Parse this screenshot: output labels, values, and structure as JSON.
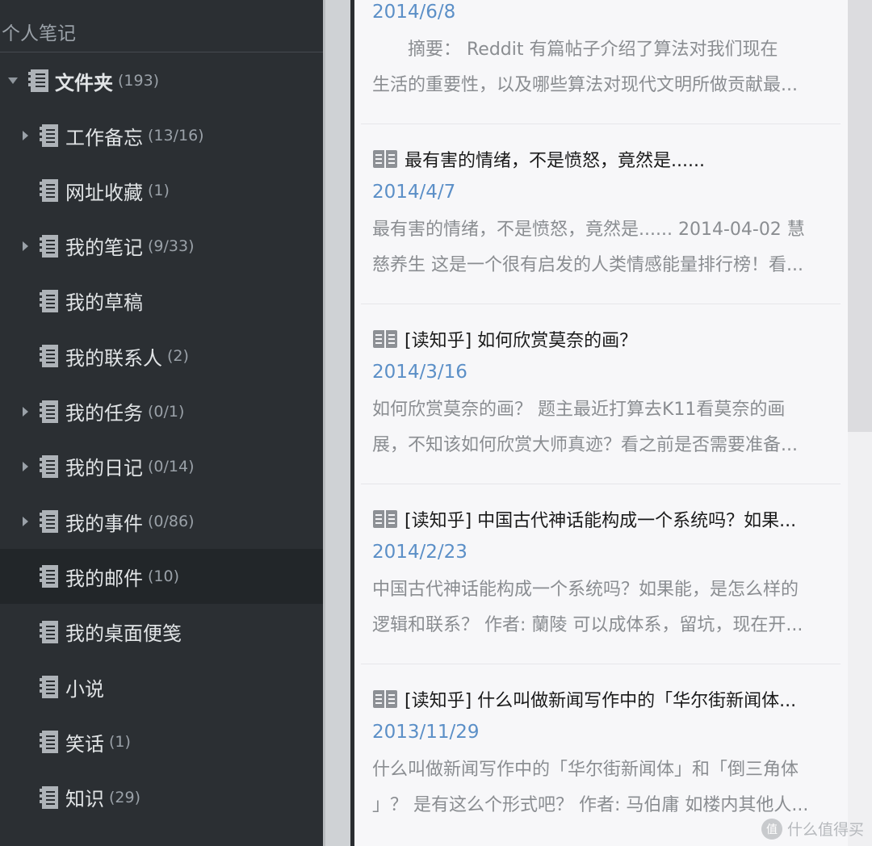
{
  "sidebar": {
    "header": "个人笔记",
    "root": {
      "label": "文件夹",
      "count": "(193)"
    },
    "items": [
      {
        "label": "工作备忘",
        "count": "(13/16)",
        "expandable": true
      },
      {
        "label": "网址收藏",
        "count": "(1)",
        "expandable": false
      },
      {
        "label": "我的笔记",
        "count": "(9/33)",
        "expandable": true
      },
      {
        "label": "我的草稿",
        "count": "",
        "expandable": false
      },
      {
        "label": "我的联系人",
        "count": "(2)",
        "expandable": false
      },
      {
        "label": "我的任务",
        "count": "(0/1)",
        "expandable": true
      },
      {
        "label": "我的日记",
        "count": "(0/14)",
        "expandable": true
      },
      {
        "label": "我的事件",
        "count": "(0/86)",
        "expandable": true
      },
      {
        "label": "我的邮件",
        "count": "(10)",
        "expandable": false,
        "selected": true
      },
      {
        "label": "我的桌面便笺",
        "count": "",
        "expandable": false
      },
      {
        "label": "小说",
        "count": "",
        "expandable": false
      },
      {
        "label": "笑话",
        "count": "(1)",
        "expandable": false
      },
      {
        "label": "知识",
        "count": "(29)",
        "expandable": false
      }
    ]
  },
  "notes": [
    {
      "title": "",
      "date": "2014/6/8",
      "snippet": [
        "　　摘要： Reddit 有篇帖子介绍了算法对我们现在",
        "生活的重要性，以及哪些算法对现代文明所做贡献最..."
      ]
    },
    {
      "title": "最有害的情绪，不是愤怒，竟然是......",
      "date": "2014/4/7",
      "snippet": [
        "最有害的情绪，不是愤怒，竟然是...... 2014-04-02 慧",
        "慈养生 这是一个很有启发的人类情感能量排行榜！看..."
      ]
    },
    {
      "title": "[读知乎] 如何欣赏莫奈的画？",
      "date": "2014/3/16",
      "snippet": [
        " 如何欣赏莫奈的画？ 题主最近打算去K11看莫奈的画",
        "展，不知该如何欣赏大师真迹？看之前是否需要准备..."
      ]
    },
    {
      "title": "[读知乎] 中国古代神话能构成一个系统吗？如果...",
      "date": "2014/2/23",
      "snippet": [
        " 中国古代神话能构成一个系统吗？如果能，是怎么样的",
        "逻辑和联系？ 作者: 蘭陵 可以成体系，留坑，现在开..."
      ]
    },
    {
      "title": "[读知乎] 什么叫做新闻写作中的「华尔街新闻体...",
      "date": "2013/11/29",
      "snippet": [
        " 什么叫做新闻写作中的「华尔街新闻体」和「倒三角体",
        "」？ 是有这么个形式吧？ 作者: 马伯庸 如楼内其他人..."
      ]
    }
  ],
  "watermark": {
    "logo": "值",
    "text": "什么值得买"
  },
  "colors": {
    "sidebar_bg": "#2b2f33",
    "selected_bg": "#222629",
    "date_blue": "#5b8fc7",
    "list_bg": "#f7f7f9"
  }
}
